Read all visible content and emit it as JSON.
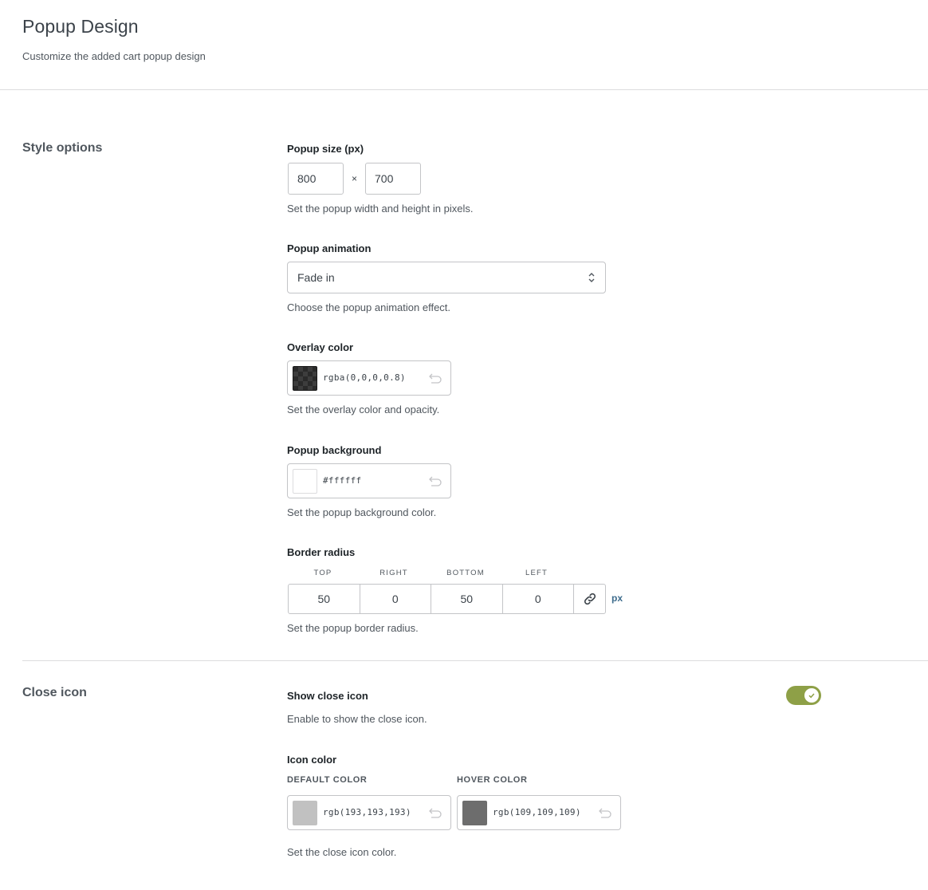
{
  "header": {
    "title": "Popup Design",
    "subtitle": "Customize the added cart popup design"
  },
  "style_options": {
    "section_title": "Style options",
    "popup_size": {
      "label": "Popup size (px)",
      "width": "800",
      "height": "700",
      "separator": "×",
      "description": "Set the popup width and height in pixels."
    },
    "popup_animation": {
      "label": "Popup animation",
      "selected": "Fade in",
      "description": "Choose the popup animation effect."
    },
    "overlay_color": {
      "label": "Overlay color",
      "value": "rgba(0,0,0,0.8)",
      "description": "Set the overlay color and opacity."
    },
    "popup_background": {
      "label": "Popup background",
      "value": "#ffffff",
      "description": "Set the popup background color."
    },
    "border_radius": {
      "label": "Border radius",
      "top_label": "TOP",
      "right_label": "RIGHT",
      "bottom_label": "BOTTOM",
      "left_label": "LEFT",
      "top": "50",
      "right": "0",
      "bottom": "50",
      "left": "0",
      "unit": "px",
      "description": "Set the popup border radius."
    }
  },
  "close_icon": {
    "section_title": "Close icon",
    "show": {
      "label": "Show close icon",
      "description": "Enable to show the close icon.",
      "enabled": true
    },
    "icon_color": {
      "label": "Icon color",
      "default_label": "DEFAULT COLOR",
      "default_value": "rgb(193,193,193)",
      "hover_label": "HOVER COLOR",
      "hover_value": "rgb(109,109,109)",
      "description": "Set the close icon color."
    }
  },
  "colors": {
    "toggle_on": "#8ea047",
    "default_swatch": "#c1c1c1",
    "hover_swatch": "#6d6d6d",
    "unit_accent": "#3c6b8c"
  }
}
